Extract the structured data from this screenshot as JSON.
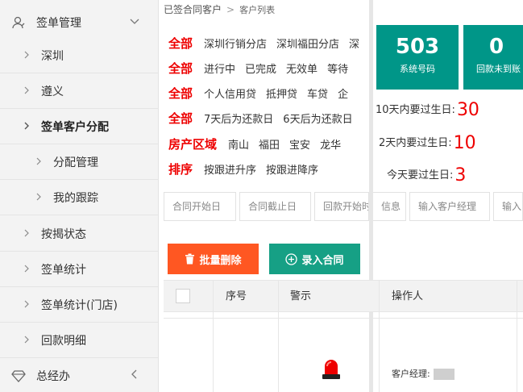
{
  "sidebar": {
    "group_top": "签单管理",
    "items": [
      {
        "label": "深圳"
      },
      {
        "label": "遵义"
      },
      {
        "label": "签单客户分配"
      },
      {
        "label": "分配管理"
      },
      {
        "label": "我的跟踪"
      },
      {
        "label": "按揭状态"
      },
      {
        "label": "签单统计"
      },
      {
        "label": "签单统计(门店)"
      },
      {
        "label": "回款明细"
      }
    ],
    "group_bottom": "总经办"
  },
  "breadcrumb": {
    "parent": "已签合同客户",
    "sep": ">",
    "current": "客户列表"
  },
  "filters": {
    "all_label": "全部",
    "store": {
      "options": [
        "深圳行销分店",
        "深圳福田分店",
        "深"
      ]
    },
    "status": {
      "options": [
        "进行中",
        "已完成",
        "无效单",
        "等待"
      ]
    },
    "type": {
      "options": [
        "个人信用贷",
        "抵押贷",
        "车贷",
        "企"
      ]
    },
    "repay": {
      "options": [
        "7天后为还款日",
        "6天后为还款日"
      ]
    },
    "area": {
      "label": "房产区域",
      "options": [
        "南山",
        "福田",
        "宝安",
        "龙华"
      ]
    },
    "sort": {
      "label": "排序",
      "options": [
        "按跟进升序",
        "按跟进降序"
      ]
    }
  },
  "stats": {
    "tile1": {
      "value": "503",
      "caption": "系统号码"
    },
    "tile2": {
      "value": "0",
      "caption": "回款未到账"
    }
  },
  "birthdays": [
    {
      "label": "10天内要过生日:",
      "count": "30"
    },
    {
      "label": "2天内要过生日:",
      "count": "10"
    },
    {
      "label": "今天要过生日:",
      "count": "3"
    }
  ],
  "inputs": {
    "contract_start": "合同开始日",
    "contract_end": "合同截止日",
    "repay_start": "回款开始时间",
    "repay_info": "信息",
    "manager": "输入客户经理",
    "more": "输入"
  },
  "actions": {
    "batch_delete": "批量删除",
    "add_contract": "录入合同"
  },
  "table": {
    "col_no": "序号",
    "col_warn": "警示",
    "col_operator": "操作人"
  },
  "row": {
    "manager_label": "客户经理:"
  },
  "colors": {
    "primary": "#009688",
    "danger": "#ff5722",
    "accent_red": "#ee0000"
  }
}
